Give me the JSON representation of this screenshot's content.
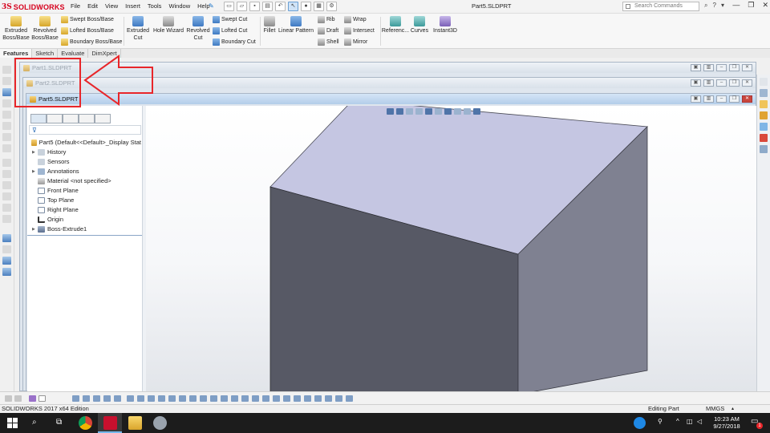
{
  "app": {
    "logo_prefix": "3S",
    "logo_text": "SOLIDWORKS",
    "document_title": "Part5.SLDPRT",
    "search_placeholder": "Search Commands"
  },
  "menu": [
    "File",
    "Edit",
    "View",
    "Insert",
    "Tools",
    "Window",
    "Help"
  ],
  "ribbon": {
    "extruded_boss": "Extruded Boss/Base",
    "revolved_boss": "Revolved Boss/Base",
    "swept_boss": "Swept Boss/Base",
    "lofted_boss": "Lofted Boss/Base",
    "boundary_boss": "Boundary Boss/Base",
    "extruded_cut": "Extruded Cut",
    "hole_wizard": "Hole Wizard",
    "revolved_cut": "Revolved Cut",
    "swept_cut": "Swept Cut",
    "lofted_cut": "Lofted Cut",
    "boundary_cut": "Boundary Cut",
    "fillet": "Fillet",
    "linear_pattern": "Linear Pattern",
    "rib": "Rib",
    "draft": "Draft",
    "shell": "Shell",
    "wrap": "Wrap",
    "intersect": "Intersect",
    "mirror": "Mirror",
    "reference": "Referenc...",
    "curves": "Curves",
    "instant3d": "Instant3D"
  },
  "tabs": [
    "Features",
    "Sketch",
    "Evaluate",
    "DimXpert"
  ],
  "windows": {
    "part1": "Part1.SLDPRT",
    "part2": "Part2.SLDPRT",
    "part5": "Part5.SLDPRT"
  },
  "tree": {
    "root": "Part5  (Default<<Default>_Display Stat",
    "items": [
      "History",
      "Sensors",
      "Annotations",
      "Material <not specified>",
      "Front Plane",
      "Top Plane",
      "Right Plane",
      "Origin",
      "Boss-Extrude1"
    ]
  },
  "status": {
    "edition": "SOLIDWORKS 2017 x64 Edition",
    "mode": "Editing Part",
    "units": "MMGS"
  },
  "taskbar": {
    "time": "10:23 AM",
    "date": "9/27/2018",
    "notification_count": "1"
  },
  "colors": {
    "brand_red": "#d6001c",
    "annotation_red": "#e8262a",
    "cube_top": "#c5c6e2",
    "cube_left": "#575965",
    "cube_right": "#7f8191"
  }
}
